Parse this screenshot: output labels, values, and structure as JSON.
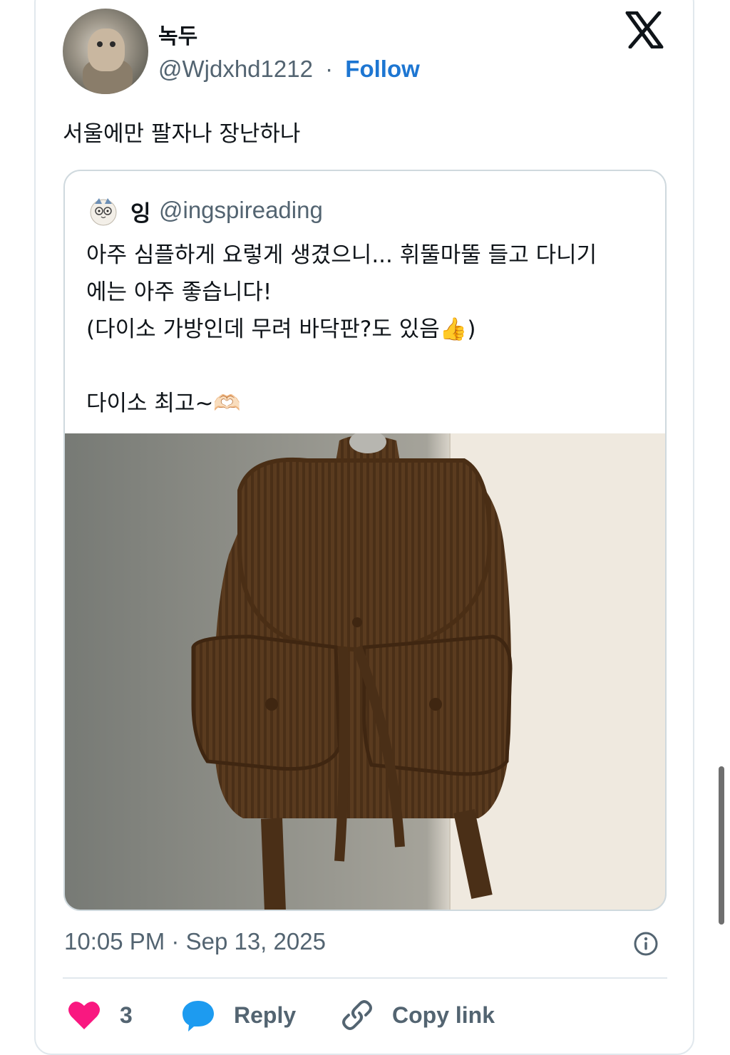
{
  "tweet": {
    "author_name": "녹두",
    "author_handle": "@Wjdxhd1212",
    "separator": "·",
    "follow_label": "Follow",
    "text": "서울에만 팔자나 장난하나",
    "timestamp": "10:05 PM · Sep 13, 2025"
  },
  "quoted_tweet": {
    "author_name": "잉",
    "author_handle": "@ingspireading",
    "text": "아주 심플하게 요렇게 생겼으니... 휘뚤마뚤 들고 다니기\n에는 아주 좋습니다!\n(다이소 가방인데 무려 바닥판?도 있음👍)\n\n다이소 최고~🫶🏻",
    "image_description_icon": "brown-corduroy-backpack-photo"
  },
  "actions": {
    "like_count": "3",
    "reply_label": "Reply",
    "copy_link_label": "Copy link"
  },
  "icons": {
    "brand": "x-logo-icon",
    "like": "heart-icon",
    "reply": "speech-bubble-icon",
    "copy": "link-icon",
    "info": "info-icon"
  },
  "colors": {
    "follow": "#1d76d2",
    "like": "#f91880",
    "reply": "#1d9bf0",
    "secondary_text": "#536471",
    "border": "#cfd9de"
  }
}
